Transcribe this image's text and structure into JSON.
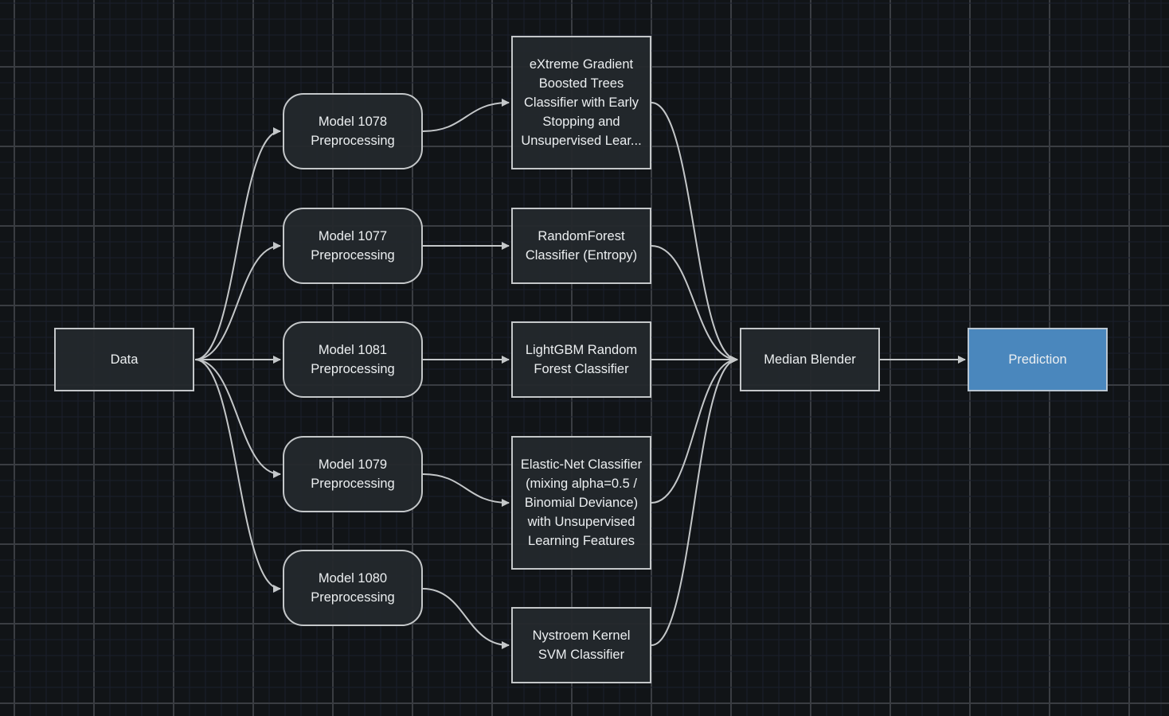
{
  "nodes": {
    "data": "Data",
    "pre1078": "Model 1078 Preprocessing",
    "pre1077": "Model 1077 Preprocessing",
    "pre1081": "Model 1081 Preprocessing",
    "pre1079": "Model 1079 Preprocessing",
    "pre1080": "Model 1080 Preprocessing",
    "xgb": "eXtreme Gradient Boosted Trees Classifier with Early Stopping and Unsupervised Lear...",
    "rf": "RandomForest Classifier (Entropy)",
    "lgbm": "LightGBM Random Forest Classifier",
    "enet": "Elastic-Net Classifier (mixing alpha=0.5 / Binomial Deviance) with Unsupervised Learning Features",
    "nys": "Nystroem Kernel SVM Classifier",
    "blender": "Median Blender",
    "prediction": "Prediction"
  },
  "colors": {
    "background": "#111417",
    "prediction": "#4a87bd",
    "edge": "#c4c7c9"
  }
}
